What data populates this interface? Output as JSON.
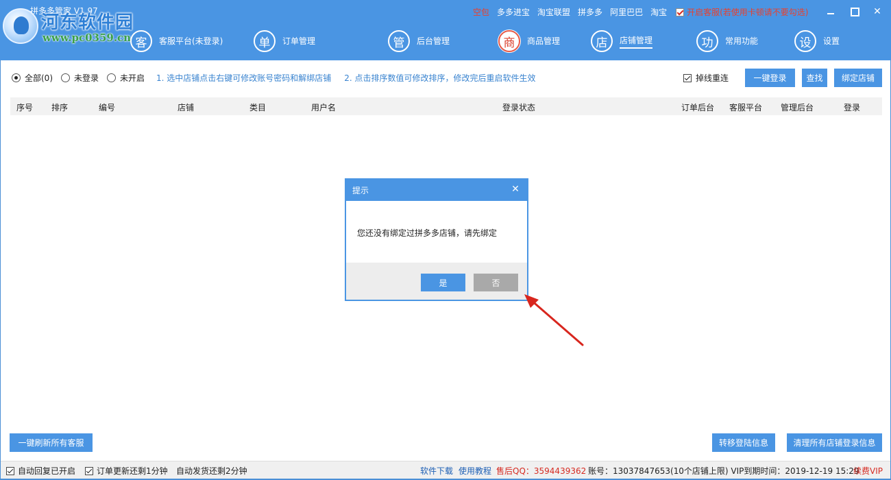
{
  "app": {
    "title": "拼多多管家 V1.97",
    "watermark_name": "河东软件园",
    "watermark_url": "www.pc0359.cn"
  },
  "top_links": [
    {
      "label": "空包",
      "color": "#e8412e"
    },
    {
      "label": "多多进宝"
    },
    {
      "label": "淘宝联盟"
    },
    {
      "label": "拼多多"
    },
    {
      "label": "阿里巴巴"
    },
    {
      "label": "淘宝"
    }
  ],
  "kefu_toggle": {
    "label": "开启客服(若使用卡顿请不要勾选)",
    "checked": true
  },
  "nav": [
    {
      "icon_char": "客",
      "label": "客服平台(未登录)",
      "active": false
    },
    {
      "icon_char": "单",
      "label": "订单管理",
      "active": false
    },
    {
      "icon_char": "管",
      "label": "后台管理",
      "active": false
    },
    {
      "icon_char": "商",
      "label": "商品管理",
      "active": true
    },
    {
      "icon_char": "店",
      "label": "店铺管理",
      "active": false,
      "selected": true
    },
    {
      "icon_char": "功",
      "label": "常用功能",
      "active": false
    },
    {
      "icon_char": "设",
      "label": "设置",
      "active": false
    }
  ],
  "filter": {
    "radios": [
      {
        "label": "全部(0)",
        "checked": true
      },
      {
        "label": "未登录",
        "checked": false
      },
      {
        "label": "未开启",
        "checked": false
      }
    ],
    "hint1": "1. 选中店铺点击右键可修改账号密码和解绑店铺",
    "hint2": "2. 点击排序数值可修改排序，修改完后重启软件生效"
  },
  "controls": {
    "reconnect_label": "掉线重连",
    "reconnect_checked": true,
    "login_all": "一键登录",
    "find": "查找",
    "bind_store": "绑定店铺"
  },
  "table": {
    "columns": [
      "序号",
      "排序",
      "编号",
      "店铺",
      "类目",
      "用户名",
      "登录状态",
      "订单后台",
      "客服平台",
      "管理后台",
      "登录"
    ],
    "rows": []
  },
  "bottom_buttons": {
    "refresh_all_kefu": "一键刷新所有客服",
    "transfer_login": "转移登陆信息",
    "clear_all_login": "清理所有店铺登录信息"
  },
  "statusbar": {
    "auto_reply": "自动回复已开启",
    "order_update": "订单更新还剩1分钟",
    "auto_ship": "自动发货还剩2分钟",
    "download": "软件下载",
    "tutorial": "使用教程",
    "after_sales_qq": "售后QQ：3594439362",
    "account": "账号：13037847653(10个店铺上限) VIP到期时间：2019-12-19 15:29",
    "renew": "续费VIP"
  },
  "dialog": {
    "title": "提示",
    "message": "您还没有绑定过拼多多店铺，请先绑定",
    "yes": "是",
    "no": "否"
  },
  "colors": {
    "header_blue": "#4a95e3",
    "accent_red": "#d62b22",
    "link_blue": "#3a84d0"
  }
}
